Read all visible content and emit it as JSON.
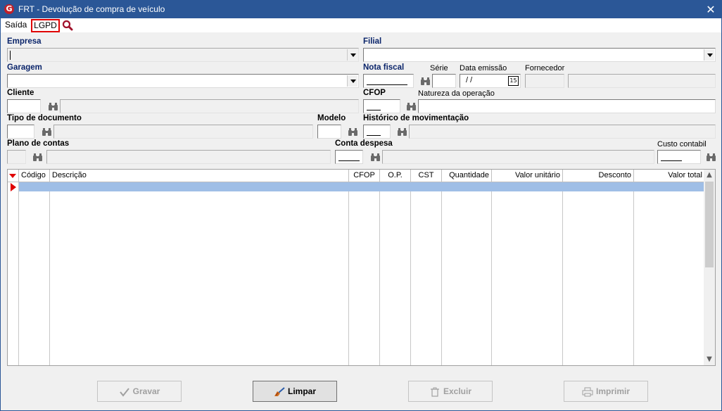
{
  "window": {
    "title": "FRT - Devolução de compra de veículo",
    "icon_letter": "G"
  },
  "menu": {
    "saida": "Saída",
    "lgpd": "LGPD"
  },
  "form": {
    "empresa": "Empresa",
    "filial": "Filial",
    "garagem": "Garagem",
    "nota_fiscal": "Nota fiscal",
    "serie": "Série",
    "data_emissao": "Data emissão",
    "data_emissao_value": "/ /",
    "calendar_day": "15",
    "fornecedor": "Fornecedor",
    "cliente": "Cliente",
    "cfop": "CFOP",
    "natureza": "Natureza da operação",
    "tipo_documento": "Tipo de documento",
    "modelo": "Modelo",
    "historico": "Histórico de movimentação",
    "plano_contas": "Plano de contas",
    "conta_despesa": "Conta despesa",
    "custo_contabil": "Custo contabil"
  },
  "grid": {
    "columns": [
      "Código",
      "Descrição",
      "CFOP",
      "O.P.",
      "CST",
      "Quantidade",
      "Valor unitário",
      "Desconto",
      "Valor total"
    ]
  },
  "buttons": {
    "gravar": "Gravar",
    "limpar": "Limpar",
    "excluir": "Excluir",
    "imprimir": "Imprimir"
  },
  "colors": {
    "title_bar": "#2b5797",
    "selection": "#9fbee6",
    "highlight_border": "#e00000"
  }
}
